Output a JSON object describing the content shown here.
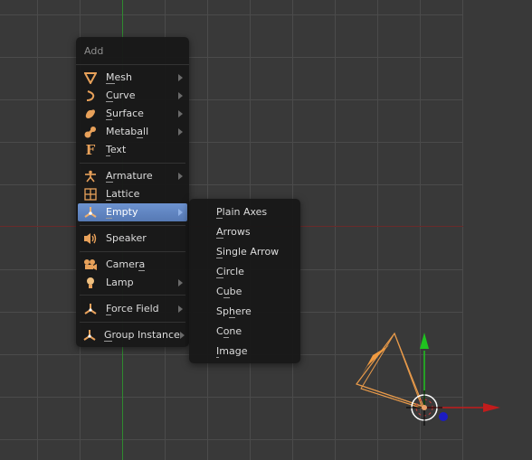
{
  "viewport": {
    "axis_colors": {
      "x": "#c21c1c",
      "y": "#1fc21f",
      "z": "#1c1cc2"
    },
    "background": "#393939"
  },
  "add_menu": {
    "title": "Add",
    "items": [
      {
        "label": "Mesh",
        "icon": "mesh-icon",
        "submenu": true,
        "underline": 0
      },
      {
        "label": "Curve",
        "icon": "curve-icon",
        "submenu": true,
        "underline": 0
      },
      {
        "label": "Surface",
        "icon": "surface-icon",
        "submenu": true,
        "underline": 0
      },
      {
        "label": "Metaball",
        "icon": "metaball-icon",
        "submenu": true,
        "underline": 5
      },
      {
        "label": "Text",
        "icon": "text-icon",
        "submenu": false,
        "underline": 0
      },
      {
        "label": "Armature",
        "icon": "armature-icon",
        "submenu": true,
        "underline": 0
      },
      {
        "label": "Lattice",
        "icon": "lattice-icon",
        "submenu": false,
        "underline": 0
      },
      {
        "label": "Empty",
        "icon": "empty-icon",
        "submenu": true,
        "underline": 0,
        "active": true
      },
      {
        "label": "Speaker",
        "icon": "speaker-icon",
        "submenu": false
      },
      {
        "label": "Camera",
        "icon": "camera-icon",
        "submenu": false,
        "underline": 5
      },
      {
        "label": "Lamp",
        "icon": "lamp-icon",
        "submenu": true
      },
      {
        "label": "Force Field",
        "icon": "force-field-icon",
        "submenu": true,
        "underline": 0
      },
      {
        "label": "Group Instance",
        "icon": "group-instance-icon",
        "submenu": true,
        "underline": 0
      }
    ]
  },
  "empty_submenu": {
    "items": [
      {
        "label": "Plain Axes",
        "underline": 0
      },
      {
        "label": "Arrows",
        "underline": 0
      },
      {
        "label": "Single Arrow",
        "underline": 0
      },
      {
        "label": "Circle",
        "underline": 0
      },
      {
        "label": "Cube",
        "underline": 1
      },
      {
        "label": "Sphere",
        "underline": 2
      },
      {
        "label": "Cone",
        "underline": 1
      },
      {
        "label": "Image",
        "underline": 0
      }
    ]
  },
  "accent_color": "#5c82c2",
  "icon_color": "#e8a15a"
}
